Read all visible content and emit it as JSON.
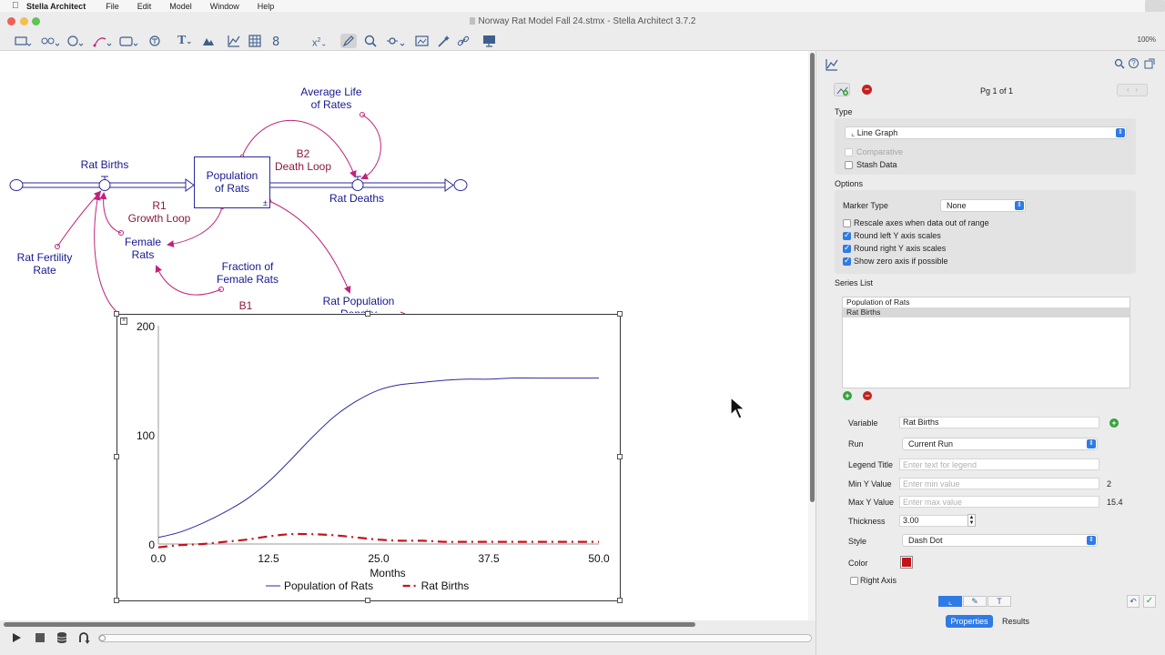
{
  "menubar": {
    "app_name": "Stella Architect",
    "items": [
      "File",
      "Edit",
      "Model",
      "Window",
      "Help"
    ]
  },
  "window": {
    "title": "Norway Rat Model Fall 24.stmx - Stella Architect 3.7.2"
  },
  "toolbar": {
    "zoom": "100%"
  },
  "diagram": {
    "labels": {
      "average_life": "Average Life\nof Rates",
      "b2": "B2\nDeath Loop",
      "rat_births": "Rat Births",
      "population": "Population\nof Rats",
      "rat_deaths": "Rat Deaths",
      "r1": "R1\nGrowth Loop",
      "female_rats": "Female\nRats",
      "rat_fertility": "Rat Fertility\nRate",
      "fraction_female": "Fraction of\nFemale Rats",
      "b1": "B1",
      "rat_pop_density": "Rat Population\nDensity"
    },
    "colors": {
      "stock": "#17188f",
      "link": "#c0247a",
      "loop": "#8a1b3a"
    }
  },
  "chart_data": {
    "type": "line",
    "title": "",
    "xlabel": "Months",
    "ylabel": "",
    "xlim": [
      0,
      50
    ],
    "ylim": [
      0,
      200
    ],
    "x_ticks": [
      "0.0",
      "12.5",
      "25.0",
      "37.5",
      "50.0"
    ],
    "y_ticks": [
      "0",
      "100",
      "200"
    ],
    "legend_position": "bottom",
    "series": [
      {
        "name": "Population of Rats",
        "color": "#2b2b9e",
        "style": "solid",
        "x": [
          0,
          2.5,
          5,
          7.5,
          10,
          12.5,
          15,
          17.5,
          20,
          22.5,
          25,
          27.5,
          30,
          32.5,
          35,
          37.5,
          40,
          42.5,
          45,
          47.5,
          50
        ],
        "y": [
          6,
          11,
          19,
          29,
          41,
          57,
          77,
          98,
          117,
          131,
          141,
          146,
          148,
          150,
          151,
          151,
          152,
          152,
          152,
          152,
          152
        ]
      },
      {
        "name": "Rat Births",
        "color": "#c4131b",
        "style": "dash-dot",
        "x": [
          0,
          2.5,
          5,
          7.5,
          10,
          12.5,
          15,
          17.5,
          20,
          22.5,
          25,
          27.5,
          30,
          32.5,
          35,
          37.5,
          40,
          42.5,
          45,
          47.5,
          50
        ],
        "y": [
          -3,
          -1,
          0,
          2,
          4,
          7,
          9,
          9,
          8,
          6,
          4,
          3,
          3,
          2,
          2,
          2,
          2,
          2,
          2,
          2,
          2
        ]
      }
    ]
  },
  "panel": {
    "page_indicator": "Pg 1 of 1",
    "type_section": {
      "title": "Type",
      "graph_type": "Line Graph",
      "comparative": "Comparative",
      "stash_data": "Stash Data"
    },
    "options_section": {
      "title": "Options",
      "marker_type_label": "Marker Type",
      "marker_type_value": "None",
      "rescale": "Rescale axes when data out of range",
      "round_left": "Round left Y axis scales",
      "round_right": "Round right Y axis scales",
      "show_zero": "Show zero axis if possible"
    },
    "series_section": {
      "title": "Series List",
      "items": [
        "Population of Rats",
        "Rat Births"
      ],
      "selected": "Rat Births"
    },
    "series_props": {
      "variable_label": "Variable",
      "variable_value": "Rat Births",
      "run_label": "Run",
      "run_value": "Current Run",
      "legend_title_label": "Legend Title",
      "legend_title_placeholder": "Enter text for legend",
      "min_y_label": "Min Y Value",
      "min_y_placeholder": "Enter min value",
      "min_y_side": "2",
      "max_y_label": "Max Y Value",
      "max_y_placeholder": "Enter max value",
      "max_y_side": "15.4",
      "thickness_label": "Thickness",
      "thickness_value": "3.00",
      "style_label": "Style",
      "style_value": "Dash Dot",
      "color_label": "Color",
      "color_value": "#c4131b",
      "right_axis": "Right Axis"
    },
    "tabs": {
      "properties": "Properties",
      "results": "Results"
    }
  }
}
